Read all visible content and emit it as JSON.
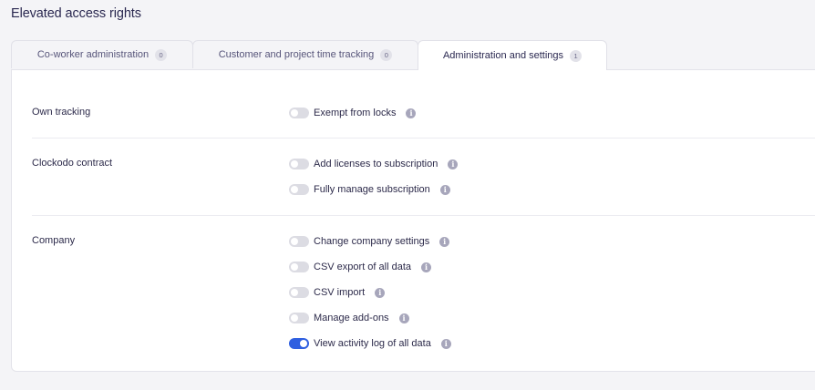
{
  "page": {
    "title": "Elevated access rights"
  },
  "tabs": [
    {
      "label": "Co-worker administration",
      "count": "0",
      "active": false
    },
    {
      "label": "Customer and project time tracking",
      "count": "0",
      "active": false
    },
    {
      "label": "Administration and settings",
      "count": "1",
      "active": true
    }
  ],
  "sections": [
    {
      "label": "Own tracking",
      "toggles": [
        {
          "label": "Exempt from locks",
          "on": false,
          "info_icon": "info-icon"
        }
      ]
    },
    {
      "label": "Clockodo contract",
      "toggles": [
        {
          "label": "Add licenses to subscription",
          "on": false,
          "info_icon": "info-icon"
        },
        {
          "label": "Fully manage subscription",
          "on": false,
          "info_icon": "info-icon"
        }
      ]
    },
    {
      "label": "Company",
      "toggles": [
        {
          "label": "Change company settings",
          "on": false,
          "info_icon": "info-icon"
        },
        {
          "label": "CSV export of all data",
          "on": false,
          "info_icon": "info-icon"
        },
        {
          "label": "CSV import",
          "on": false,
          "info_icon": "info-icon"
        },
        {
          "label": "Manage add-ons",
          "on": false,
          "info_icon": "info-icon"
        },
        {
          "label": "View activity log of all data",
          "on": true,
          "info_icon": "info-icon"
        }
      ]
    }
  ],
  "colors": {
    "toggle_on": "#2f5fe0",
    "toggle_off": "#dcdce3",
    "info_icon": "#a7a6bb"
  }
}
